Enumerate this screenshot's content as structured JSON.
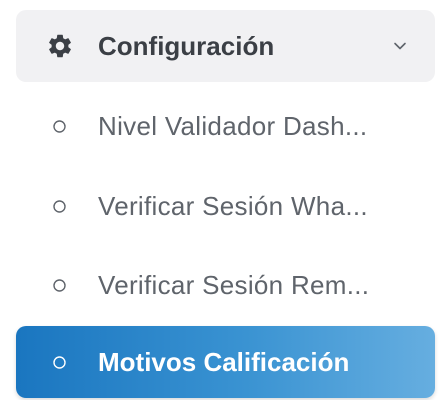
{
  "menu": {
    "group": {
      "icon": "gear-icon",
      "label": "Configuración",
      "expand_icon": "chevron-down-icon",
      "expanded": true
    },
    "items": [
      {
        "label": "Nivel Validador Dash...",
        "active": false,
        "icon": "circle-outline-icon"
      },
      {
        "label": "Verificar Sesión Wha...",
        "active": false,
        "icon": "circle-outline-icon"
      },
      {
        "label": "Verificar Sesión Rem...",
        "active": false,
        "icon": "circle-outline-icon"
      },
      {
        "label": "Motivos Calificación",
        "active": true,
        "icon": "circle-outline-icon"
      }
    ]
  },
  "colors": {
    "header_bg": "#f1f1f3",
    "header_text": "#3b3f45",
    "item_text": "#5f646b",
    "active_bg_start": "#1a76c0",
    "active_bg_end": "#66aee0",
    "active_text": "#ffffff"
  }
}
